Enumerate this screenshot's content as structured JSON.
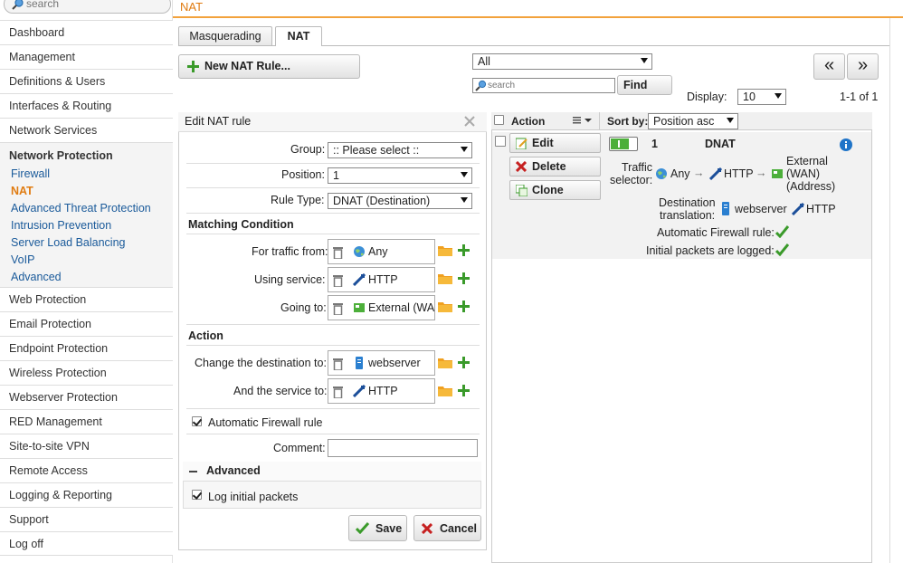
{
  "sidebar": {
    "search_placeholder": "search",
    "items_top": [
      "Dashboard",
      "Management",
      "Definitions & Users",
      "Interfaces & Routing",
      "Network Services"
    ],
    "active_group": "Network Protection",
    "sub_items": [
      "Firewall",
      "NAT",
      "Advanced Threat Protection",
      "Intrusion Prevention",
      "Server Load Balancing",
      "VoIP",
      "Advanced"
    ],
    "active_sub": "NAT",
    "items_bottom": [
      "Web Protection",
      "Email Protection",
      "Endpoint Protection",
      "Wireless Protection",
      "Webserver Protection",
      "RED Management",
      "Site-to-site VPN",
      "Remote Access",
      "Logging & Reporting",
      "Support",
      "Log off"
    ]
  },
  "header": {
    "title": "NAT"
  },
  "tabs": [
    {
      "label": "Masquerading"
    },
    {
      "label": "NAT"
    }
  ],
  "toolbar": {
    "new_rule_label": "New NAT Rule...",
    "filter_value": "All",
    "search_placeholder": "search",
    "find_label": "Find",
    "display_label": "Display:",
    "display_value": "10",
    "paging_text": "1-1 of 1",
    "first_page_glyph": "«",
    "next_page_glyph": "»"
  },
  "edit_form": {
    "title": "Edit NAT rule",
    "group_label": "Group:",
    "group_value": ":: Please select ::",
    "position_label": "Position:",
    "position_value": "1",
    "rule_type_label": "Rule Type:",
    "rule_type_value": "DNAT (Destination)",
    "matching_heading": "Matching Condition",
    "traffic_from_label": "For traffic from:",
    "traffic_from_value": "Any",
    "using_service_label": "Using service:",
    "using_service_value": "HTTP",
    "going_to_label": "Going to:",
    "going_to_value": "External (WAN",
    "action_heading": "Action",
    "change_dest_label": "Change the destination to:",
    "change_dest_value": "webserver",
    "service_to_label": "And the service to:",
    "service_to_value": "HTTP",
    "auto_fw_label": "Automatic Firewall rule",
    "comment_label": "Comment:",
    "comment_value": "",
    "advanced_heading": "Advanced",
    "log_initial_label": "Log initial packets",
    "save_label": "Save",
    "cancel_label": "Cancel"
  },
  "list": {
    "action_header": "Action",
    "sort_label": "Sort by:",
    "sort_value": "Position asc",
    "edit_label": "Edit",
    "delete_label": "Delete",
    "clone_label": "Clone",
    "rule": {
      "number": "1",
      "type": "DNAT",
      "traffic_selector_label_1": "Traffic",
      "traffic_selector_label_2": "selector:",
      "source": "Any",
      "arrow": "→",
      "service": "HTTP",
      "destination_1": "External",
      "destination_2": "(WAN)",
      "destination_3": "(Address)",
      "dest_translation_label_1": "Destination",
      "dest_translation_label_2": "translation:",
      "translation_host": "webserver",
      "translation_service": "HTTP",
      "auto_fw_label": "Automatic Firewall rule:",
      "logged_label": "Initial packets are logged:"
    }
  },
  "colors": {
    "accent": "#f2a23c",
    "link": "#1a5a9a",
    "green": "#3a9a2a",
    "red": "#c62020"
  }
}
